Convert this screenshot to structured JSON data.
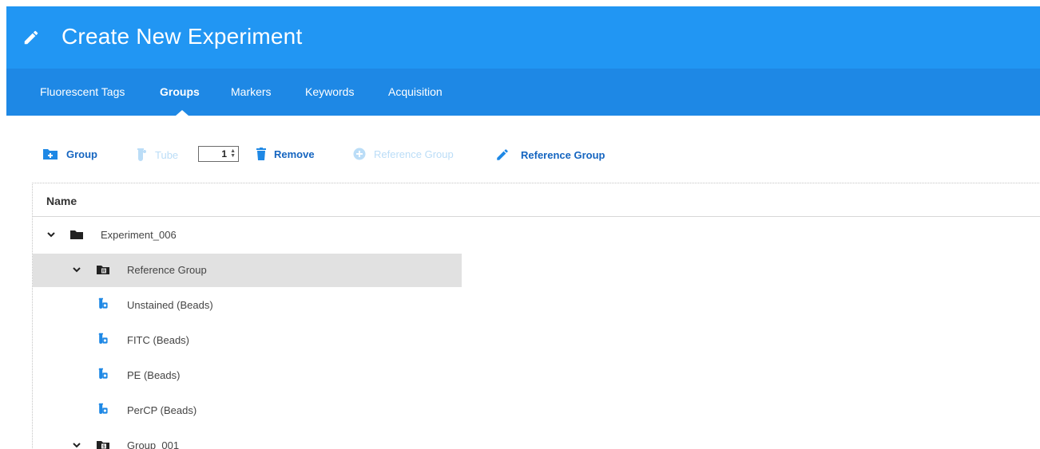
{
  "window": {
    "title": "Create New Experiment",
    "title_icon": "pencil-icon"
  },
  "tabs": [
    {
      "label": "Fluorescent Tags"
    },
    {
      "label": "Groups",
      "active": true
    },
    {
      "label": "Markers"
    },
    {
      "label": "Keywords"
    },
    {
      "label": "Acquisition"
    }
  ],
  "toolbar": {
    "group_label": "Group",
    "tube_label": "Tube",
    "tube_count": "1",
    "remove_label": "Remove",
    "add_reference_group_label": "Reference Group",
    "edit_reference_group_label": "Reference Group"
  },
  "grid": {
    "column_name": "Name",
    "rows": [
      {
        "label": "Experiment_006",
        "type": "folder",
        "expanded": true,
        "level": 0
      },
      {
        "label": "Reference Group",
        "type": "reference-group",
        "badge": "R",
        "expanded": true,
        "level": 1,
        "selected": true
      },
      {
        "label": "Unstained (Beads)",
        "type": "tube",
        "level": 2
      },
      {
        "label": "FITC (Beads)",
        "type": "tube",
        "level": 2
      },
      {
        "label": "PE (Beads)",
        "type": "tube",
        "level": 2
      },
      {
        "label": "PerCP (Beads)",
        "type": "tube",
        "level": 2
      },
      {
        "label": "Group_001",
        "type": "sample-group",
        "badge": "S",
        "expanded": true,
        "level": 1
      }
    ]
  },
  "colors": {
    "title_bar": "#2196F3",
    "tab_bar": "#1E88E5",
    "action_enabled": "#1565C0",
    "action_disabled": "#BBDDF7",
    "tube_icon": "#1E88E5",
    "selected_row": "#E1E1E1"
  }
}
